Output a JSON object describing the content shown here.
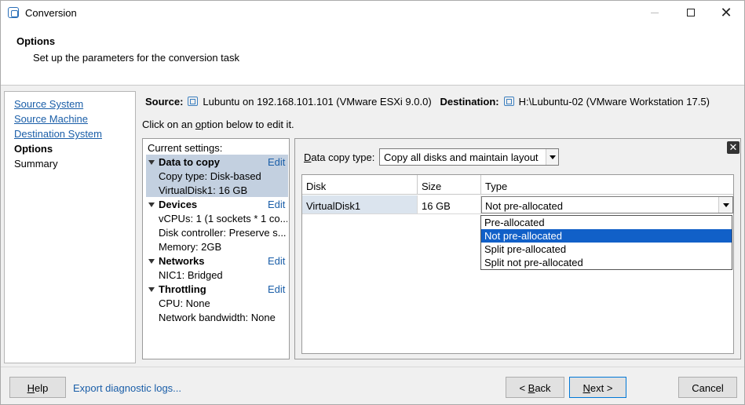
{
  "window": {
    "title": "Conversion",
    "close_glyph": "✕"
  },
  "header": {
    "title": "Options",
    "subtitle": "Set up the parameters for the conversion task"
  },
  "nav": {
    "items": [
      {
        "label": "Source System",
        "state": "link"
      },
      {
        "label": "Source Machine",
        "state": "link"
      },
      {
        "label": "Destination System",
        "state": "link"
      },
      {
        "label": "Options",
        "state": "current"
      },
      {
        "label": "Summary",
        "state": "pending"
      }
    ]
  },
  "summary": {
    "source_label": "Source:",
    "source_value": "Lubuntu on 192.168.101.101 (VMware ESXi 9.0.0)",
    "destination_label": "Destination:",
    "destination_value": "H:\\Lubuntu-02 (VMware Workstation 17.5)",
    "hint_pre": "Click on an ",
    "hint_u": "o",
    "hint_post": "ption below to edit it."
  },
  "settings": {
    "current_label": "Current settings:",
    "edit_label": "Edit",
    "sections": [
      {
        "title": "Data to copy",
        "values": [
          "Copy type: Disk-based",
          "VirtualDisk1: 16 GB"
        ],
        "selected": true
      },
      {
        "title": "Devices",
        "values": [
          "vCPUs: 1 (1 sockets * 1 co...",
          "Disk controller: Preserve s...",
          "Memory: 2GB"
        ]
      },
      {
        "title": "Networks",
        "values": [
          "NIC1: Bridged"
        ]
      },
      {
        "title": "Throttling",
        "values": [
          "CPU: None",
          "Network bandwidth: None"
        ]
      }
    ]
  },
  "editor": {
    "close_glyph": "✕",
    "data_copy_label_u": "D",
    "data_copy_label_rest": "ata copy type:",
    "data_copy_value": "Copy all disks and maintain layout",
    "table": {
      "headers": [
        "Disk",
        "Size",
        "Type"
      ],
      "rows": [
        {
          "disk": "VirtualDisk1",
          "size": "16 GB",
          "type": "Not pre-allocated"
        }
      ]
    },
    "type_options": [
      "Pre-allocated",
      "Not pre-allocated",
      "Split pre-allocated",
      "Split not pre-allocated"
    ],
    "type_selected_index": 1
  },
  "footer": {
    "help_u": "H",
    "help_rest": "elp",
    "export_label": "Export diagnostic logs...",
    "back_pre": "< ",
    "back_u": "B",
    "back_rest": "ack",
    "next_u": "N",
    "next_rest": "ext >",
    "cancel_label": "Cancel"
  },
  "colors": {
    "link": "#1a5ea8",
    "selection": "#c3d0e0",
    "dropdown_highlight": "#1160c8"
  }
}
